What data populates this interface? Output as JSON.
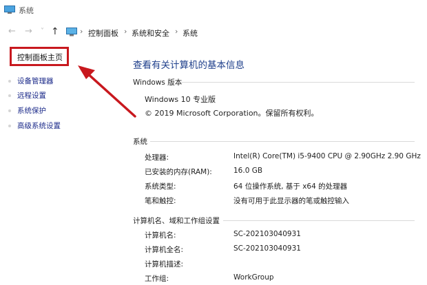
{
  "window": {
    "title": "系统"
  },
  "nav": {
    "back": "←",
    "forward": "→",
    "recent": "˅",
    "up": "↑"
  },
  "breadcrumb": {
    "sep": "›",
    "items": [
      "控制面板",
      "系统和安全",
      "系统"
    ]
  },
  "sidebar": {
    "home": "控制面板主页",
    "links": [
      "设备管理器",
      "远程设置",
      "系统保护",
      "高级系统设置"
    ]
  },
  "main": {
    "title": "查看有关计算机的基本信息",
    "edition": {
      "header": "Windows 版本",
      "name": "Windows 10 专业版",
      "copyright": "© 2019 Microsoft Corporation。保留所有权利。"
    },
    "system": {
      "header": "系统",
      "rows": [
        {
          "label": "处理器:",
          "value": "Intel(R) Core(TM) i5-9400 CPU @ 2.90GHz   2.90 GHz"
        },
        {
          "label": "已安装的内存(RAM):",
          "value": "16.0 GB"
        },
        {
          "label": "系统类型:",
          "value": "64 位操作系统, 基于 x64 的处理器"
        },
        {
          "label": "笔和触控:",
          "value": "没有可用于此显示器的笔或触控输入"
        }
      ]
    },
    "computer": {
      "header": "计算机名、域和工作组设置",
      "rows": [
        {
          "label": "计算机名:",
          "value": "SC-202103040931"
        },
        {
          "label": "计算机全名:",
          "value": "SC-202103040931"
        },
        {
          "label": "计算机描述:",
          "value": ""
        },
        {
          "label": "工作组:",
          "value": "WorkGroup"
        }
      ]
    }
  },
  "colors": {
    "highlight": "#c8181e",
    "title": "#1e3f8b",
    "link": "#1c2b8a"
  }
}
